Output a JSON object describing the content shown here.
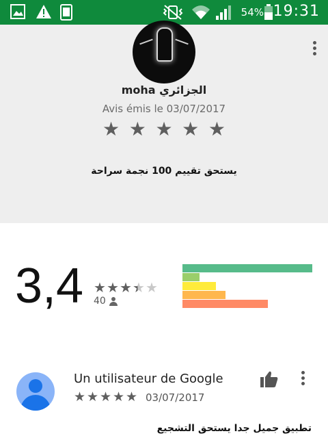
{
  "status_bar": {
    "battery": "54%",
    "time": "19:31",
    "icons": [
      "image-icon",
      "warning-icon",
      "screenshot-icon",
      "vibrate-mute-icon",
      "wifi-icon",
      "signal-icon",
      "battery-icon"
    ],
    "bg_color": "#0f8a3c"
  },
  "review_card": {
    "avatar_icon": "light-bulb-avatar",
    "reviewer_name": "moha الجزائري",
    "date": "Avis émis le 03/07/2017",
    "stars": 5,
    "text": "يستحق تقييم 100 نجمة سراحة",
    "menu_icon": "more-vert-icon"
  },
  "rating_summary": {
    "average": "3,4",
    "stars_value": 3.4,
    "count": "40",
    "count_icon": "person-icon",
    "distribution": [
      {
        "stars": 5,
        "fraction": 1.0,
        "color": "#57bb8a"
      },
      {
        "stars": 4,
        "fraction": 0.13,
        "color": "#9ace6a"
      },
      {
        "stars": 3,
        "fraction": 0.26,
        "color": "#ffeb3b"
      },
      {
        "stars": 2,
        "fraction": 0.33,
        "color": "#ffb74d"
      },
      {
        "stars": 1,
        "fraction": 0.66,
        "color": "#ff8a65"
      }
    ]
  },
  "user_review": {
    "name": "Un utilisateur de Google",
    "stars": 5,
    "date": "03/07/2017",
    "text": "تطبيق جميل جدا يستحق التشجيع",
    "thumb_icon": "thumb-up-icon",
    "menu_icon": "more-vert-icon"
  }
}
